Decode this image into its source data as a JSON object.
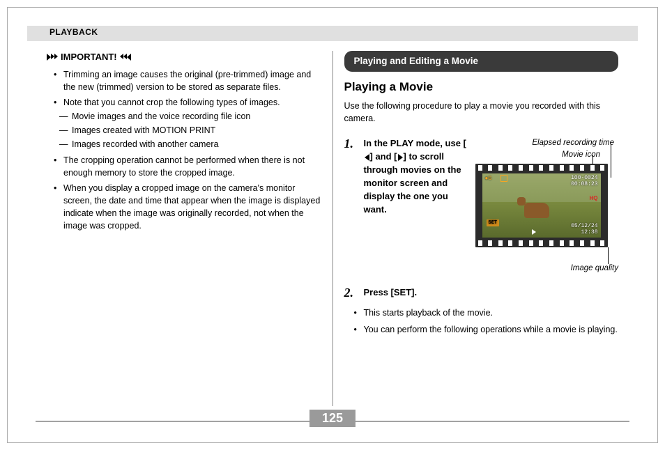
{
  "header": {
    "section": "PLAYBACK"
  },
  "left": {
    "important": "IMPORTANT!",
    "bullets": [
      "Trimming an image causes the original (pre-trimmed) image and the new (trimmed) version to be stored as separate files.",
      "Note that you cannot crop the following types of images.",
      "The cropping operation cannot be performed when there is not enough memory to store the cropped image.",
      "When you display a cropped image on the camera's monitor screen, the date and time that appear when the image is displayed indicate when the image was originally recorded, not when the image was cropped."
    ],
    "dash": [
      "Movie images and the voice recording file icon",
      "Images created with MOTION PRINT",
      "Images recorded with another camera"
    ]
  },
  "right": {
    "pill": "Playing and Editing a Movie",
    "subhead": "Playing a Movie",
    "intro": "Use the following procedure to play a movie you recorded with this camera.",
    "step1_pre": "In the PLAY mode, use [",
    "step1_mid": "] and [",
    "step1_post": "] to scroll through movies on the monitor screen and display the one you want.",
    "callout_elapsed": "Elapsed recording time",
    "callout_movie_icon": "Movie icon",
    "callout_quality": "Image quality",
    "step2": "Press [SET].",
    "step2_sub": [
      "This starts playback of the movie.",
      "You can perform the following operations while a movie is playing."
    ]
  },
  "osd": {
    "file": "100-0024",
    "elapsed": "00:08:23",
    "quality": "HQ",
    "date": "05/12/24",
    "time": "12:38",
    "set": "SET",
    "rec_icon": "G"
  },
  "page_number": "125"
}
